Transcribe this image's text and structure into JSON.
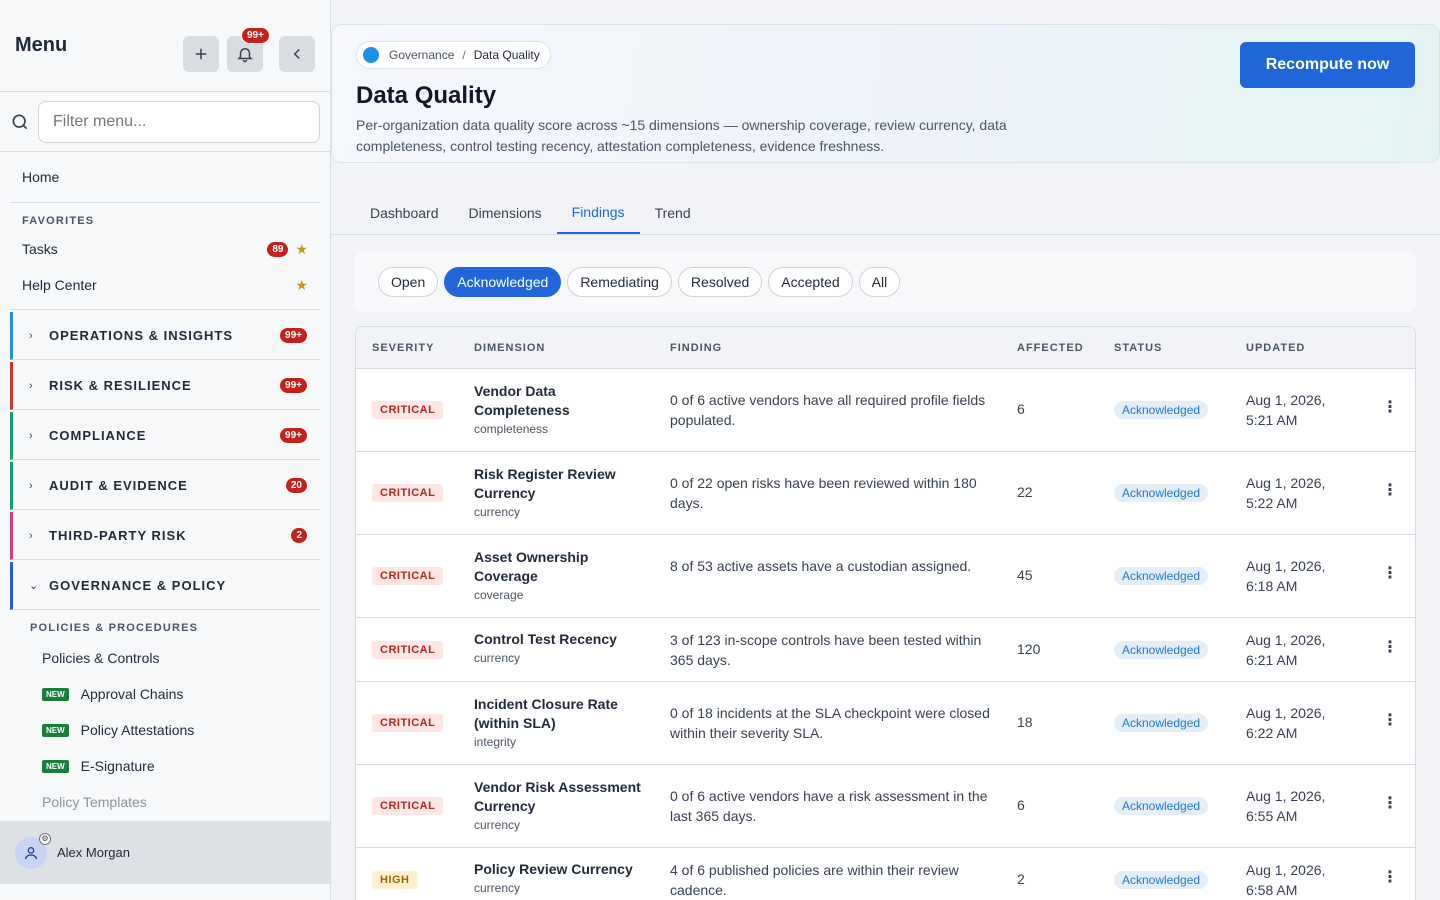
{
  "sidebar": {
    "title": "Menu",
    "notif_badge": "99+",
    "search_placeholder": "Filter menu...",
    "home": "Home",
    "favorites_label": "FAVORITES",
    "favorites": [
      {
        "label": "Tasks",
        "badge": "89"
      },
      {
        "label": "Help Center",
        "badge": ""
      }
    ],
    "groups": [
      {
        "label": "OPERATIONS & INSIGHTS",
        "badge": "99+",
        "color": "#2b8fd6"
      },
      {
        "label": "RISK & RESILIENCE",
        "badge": "99+",
        "color": "#d9342b"
      },
      {
        "label": "COMPLIANCE",
        "badge": "99+",
        "color": "#1a9e6b"
      },
      {
        "label": "AUDIT & EVIDENCE",
        "badge": "20",
        "color": "#1a9e6b"
      },
      {
        "label": "THIRD-PARTY RISK",
        "badge": "2",
        "color": "#d43d86"
      },
      {
        "label": "GOVERNANCE & POLICY",
        "badge": "",
        "color": "#2a5bd7"
      }
    ],
    "subsection": "POLICIES & PROCEDURES",
    "new_label": "NEW",
    "subitems": [
      {
        "label": "Policies & Controls",
        "new": false
      },
      {
        "label": "Approval Chains",
        "new": true
      },
      {
        "label": "Policy Attestations",
        "new": true
      },
      {
        "label": "E-Signature",
        "new": true
      },
      {
        "label": "Policy Templates",
        "new": false
      }
    ],
    "user": "Alex Morgan"
  },
  "header": {
    "crumb_parent": "Governance",
    "crumb_sep": "/",
    "crumb_current": "Data Quality",
    "title": "Data Quality",
    "description": "Per-organization data quality score across ~15 dimensions — ownership coverage, review currency, data completeness, control testing recency, attestation completeness, evidence freshness.",
    "recompute": "Recompute now"
  },
  "tabs": [
    "Dashboard",
    "Dimensions",
    "Findings",
    "Trend"
  ],
  "active_tab": "Findings",
  "filters": [
    "Open",
    "Acknowledged",
    "Remediating",
    "Resolved",
    "Accepted",
    "All"
  ],
  "active_filter": "Acknowledged",
  "table": {
    "headers": {
      "severity": "SEVERITY",
      "dimension": "DIMENSION",
      "finding": "FINDING",
      "affected": "AFFECTED",
      "status": "STATUS",
      "updated": "UPDATED"
    },
    "rows": [
      {
        "severity": "CRITICAL",
        "level": "critical",
        "dim_name": "Vendor Data Completeness",
        "dim_key": "completeness",
        "finding": "0 of 6 active vendors have all required profile fields populated.",
        "affected": "6",
        "status": "Acknowledged",
        "updated": "Aug 1, 2026, 5:21 AM"
      },
      {
        "severity": "CRITICAL",
        "level": "critical",
        "dim_name": "Risk Register Review Currency",
        "dim_key": "currency",
        "finding": "0 of 22 open risks have been reviewed within 180 days.",
        "affected": "22",
        "status": "Acknowledged",
        "updated": "Aug 1, 2026, 5:22 AM"
      },
      {
        "severity": "CRITICAL",
        "level": "critical",
        "dim_name": "Asset Ownership Coverage",
        "dim_key": "coverage",
        "finding": "8 of 53 active assets have a custodian assigned.",
        "affected": "45",
        "status": "Acknowledged",
        "updated": "Aug 1, 2026, 6:18 AM"
      },
      {
        "severity": "CRITICAL",
        "level": "critical",
        "dim_name": "Control Test Recency",
        "dim_key": "currency",
        "finding": "3 of 123 in-scope controls have been tested within 365 days.",
        "affected": "120",
        "status": "Acknowledged",
        "updated": "Aug 1, 2026, 6:21 AM"
      },
      {
        "severity": "CRITICAL",
        "level": "critical",
        "dim_name": "Incident Closure Rate (within SLA)",
        "dim_key": "integrity",
        "finding": "0 of 18 incidents at the SLA checkpoint were closed within their severity SLA.",
        "affected": "18",
        "status": "Acknowledged",
        "updated": "Aug 1, 2026, 6:22 AM"
      },
      {
        "severity": "CRITICAL",
        "level": "critical",
        "dim_name": "Vendor Risk Assessment Currency",
        "dim_key": "currency",
        "finding": "0 of 6 active vendors have a risk assessment in the last 365 days.",
        "affected": "6",
        "status": "Acknowledged",
        "updated": "Aug 1, 2026, 6:55 AM"
      },
      {
        "severity": "HIGH",
        "level": "high",
        "dim_name": "Policy Review Currency",
        "dim_key": "currency",
        "finding": "4 of 6 published policies are within their review cadence.",
        "affected": "2",
        "status": "Acknowledged",
        "updated": "Aug 1, 2026, 6:58 AM"
      }
    ]
  }
}
